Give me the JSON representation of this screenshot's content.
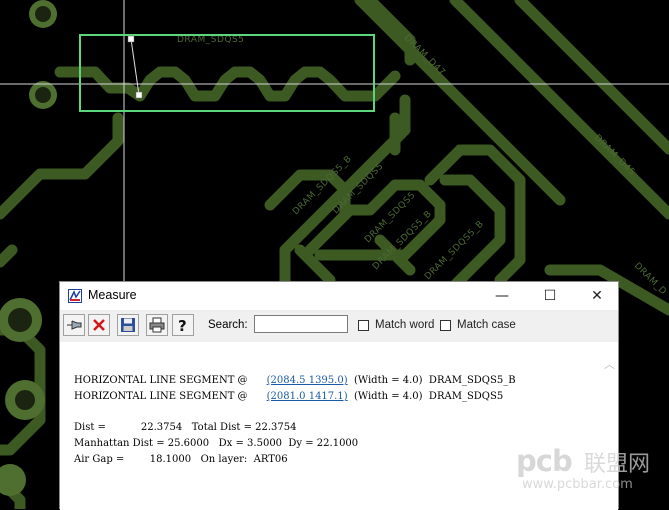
{
  "canvas": {
    "trace_labels": [
      "DRAM_SDQS5",
      "DRAM_D47",
      "DRAM_D45",
      "DRAM_SDQS5_B",
      "DRAM_SDQS5",
      "DRAM_SDQS5",
      "DRAM_SDQS5_B",
      "DRAM_SDQS5_B",
      "DRAM_D"
    ],
    "colors": {
      "background": "#000000",
      "trace": "#3d5a23",
      "pad": "#4e6f2f",
      "measure_box": "#5cd67a",
      "crosshair": "#d8d8d8"
    }
  },
  "window": {
    "title": "Measure",
    "minimize_glyph": "—",
    "maximize_glyph": "☐",
    "close_glyph": "✕"
  },
  "toolbar": {
    "search_label": "Search:",
    "search_value": "",
    "match_word_label": "Match word",
    "match_case_label": "Match case",
    "match_word_checked": false,
    "match_case_checked": false
  },
  "measure": {
    "seg1_prefix": "HORIZONTAL LINE SEGMENT @",
    "seg1_coord": "(2084.5 1395.0)",
    "seg1_suffix": "(Width = 4.0)  DRAM_SDQS5_B",
    "seg2_prefix": "HORIZONTAL LINE SEGMENT @",
    "seg2_coord": "(2081.0 1417.1)",
    "seg2_suffix": "(Width = 4.0)  DRAM_SDQS5",
    "line_dist": "Dist =           22.3754   Total Dist = 22.3754",
    "line_manhattan": "Manhattan Dist = 25.6000   Dx = 3.5000  Dy = 22.1000",
    "line_airgap": "Air Gap =        18.1000   On layer:  ART06"
  },
  "watermark": {
    "brand": "pcb",
    "brand_cn": "联盟网",
    "url": "www.pcbbar.com"
  }
}
